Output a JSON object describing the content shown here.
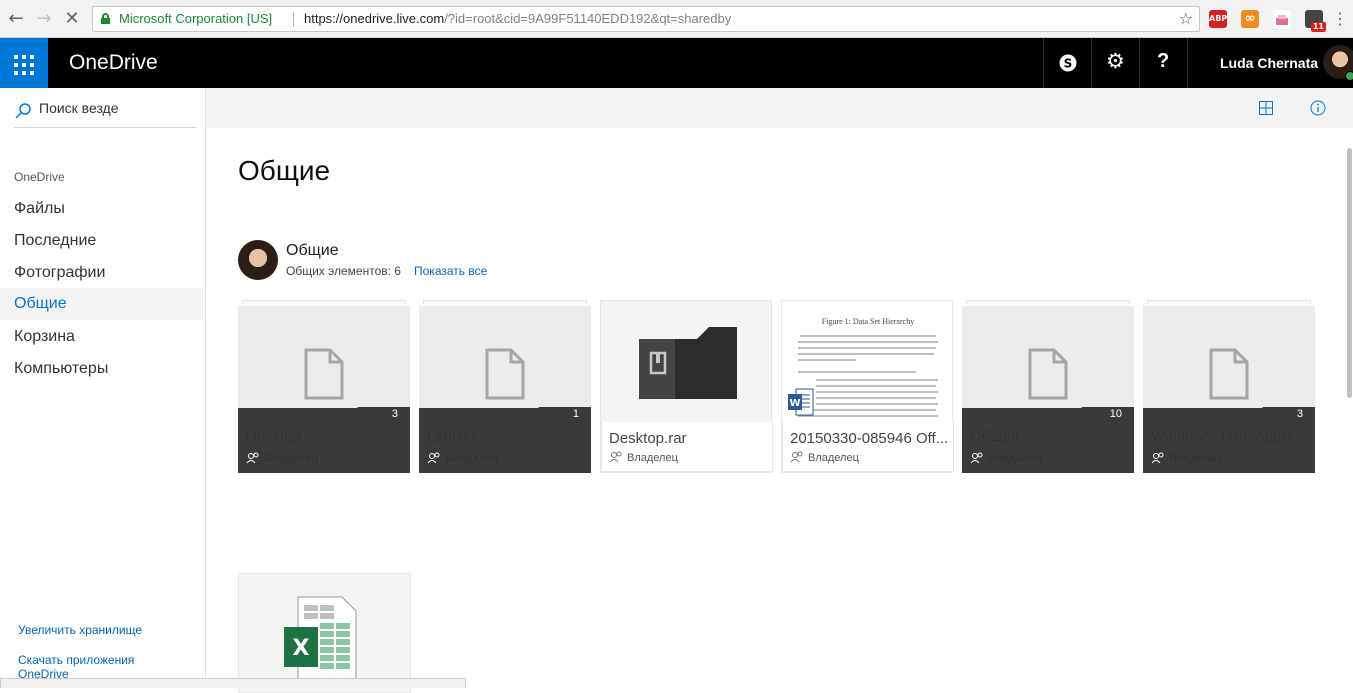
{
  "browser": {
    "security_label": "Microsoft Corporation [US]",
    "url_host": "https://onedrive.live.com",
    "url_path": "/?id=root&cid=9A99F51140EDD192&qt=sharedby",
    "back_icon": "arrow-left-icon",
    "forward_icon": "arrow-right-icon",
    "stop_icon": "close-icon",
    "extensions": [
      {
        "name": "adblock-icon",
        "label": "ABP",
        "color": "#d6201f"
      },
      {
        "name": "infinity-icon",
        "label": "∞",
        "color": "#f08c1e"
      },
      {
        "name": "cake-icon",
        "label": "",
        "color": "#e0709a"
      },
      {
        "name": "messenger-icon",
        "label": "11",
        "color": "#444444"
      }
    ]
  },
  "appbar": {
    "brand": "OneDrive",
    "user_name": "Luda Chernata",
    "accent": "#0078d7"
  },
  "sidebar": {
    "search_label": "Поиск везде",
    "section_label": "OneDrive",
    "items": [
      {
        "label": "Файлы",
        "active": false
      },
      {
        "label": "Последние",
        "active": false
      },
      {
        "label": "Фотографии",
        "active": false
      },
      {
        "label": "Общие",
        "active": true
      },
      {
        "label": "Корзина",
        "active": false
      },
      {
        "label": "Компьютеры",
        "active": false
      }
    ],
    "upgrade_link": "Увеличить хранилище",
    "apps_link_line1": "Скачать приложения",
    "apps_link_line2": "OneDrive"
  },
  "main": {
    "title": "Общие",
    "group": {
      "title": "Общие",
      "count_label": "Общих элементов: 6",
      "show_all": "Показать все"
    },
    "tiles": [
      {
        "kind": "folder",
        "name": "Desktop",
        "count": "3",
        "role": "Владелец"
      },
      {
        "kind": "folder",
        "name": "Labfiles",
        "count": "1",
        "role": "Владелец"
      },
      {
        "kind": "archive",
        "name": "Desktop.rar",
        "role": "Владелец"
      },
      {
        "kind": "word",
        "name": "20150330-085946 Off...",
        "role": "Владелец",
        "preview_heading": "Figure 1: Data Set Hierarchy"
      },
      {
        "kind": "folder",
        "name": "Общая",
        "count": "10",
        "role": "Владелец"
      },
      {
        "kind": "folder",
        "name": "WindowsFormsApplic...",
        "count": "3",
        "role": "Владелец"
      }
    ]
  }
}
